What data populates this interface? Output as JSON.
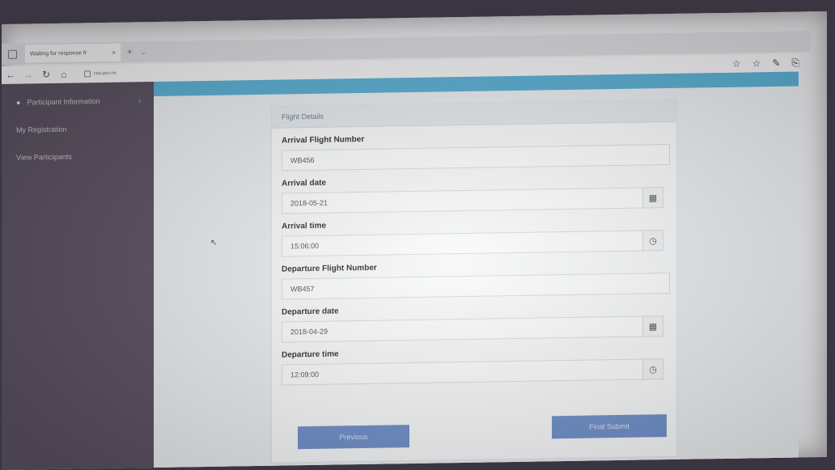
{
  "browser": {
    "tab_title": "Waiting for response fr",
    "tab_close": "×",
    "new_tab": "+",
    "tab_more": "⌄",
    "address": "raa.gov.rw",
    "back": "←",
    "forward": "→",
    "refresh": "↻",
    "home": "⌂",
    "toolbar_icons": {
      "favorite": "☆",
      "favorites_bar": "☆",
      "notes": "✎",
      "share": "⎘"
    },
    "window_controls": {
      "minimize": "—",
      "restore": "□",
      "close": "×"
    }
  },
  "sidebar": {
    "items": [
      {
        "label": "Participant Information",
        "icon": "user-icon"
      },
      {
        "label": "My Registration"
      },
      {
        "label": "View Participants"
      }
    ],
    "chevron": "‹"
  },
  "form": {
    "title": "Flight Details",
    "fields": [
      {
        "label": "Arrival Flight Number",
        "value": "WB456"
      },
      {
        "label": "Arrival date",
        "value": "2018-05-21",
        "icon": "calendar-icon",
        "glyph": "▦"
      },
      {
        "label": "Arrival time",
        "value": "15:06:00",
        "icon": "clock-icon",
        "glyph": "◷"
      },
      {
        "label": "Departure Flight Number",
        "value": "WB457"
      },
      {
        "label": "Departure date",
        "value": "2018-04-29",
        "icon": "calendar-icon",
        "glyph": "▦"
      },
      {
        "label": "Departure time",
        "value": "12:09:00",
        "icon": "clock-icon",
        "glyph": "◷"
      }
    ],
    "previous_label": "Previous",
    "submit_label": "Final Submit"
  },
  "colors": {
    "sidebar": "#5a5060",
    "topbar": "#5aaed3",
    "button": "#6e8fc9"
  }
}
